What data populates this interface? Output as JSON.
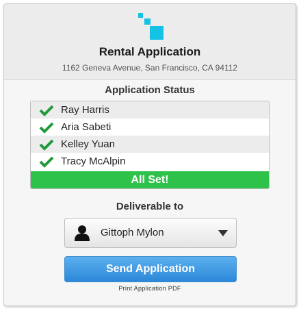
{
  "header": {
    "title": "Rental Application",
    "address": "1162 Geneva Avenue, San Francisco, CA 94112"
  },
  "status": {
    "label": "Application Status",
    "applicants": [
      {
        "name": "Ray Harris",
        "checked": true
      },
      {
        "name": "Aria Sabeti",
        "checked": true
      },
      {
        "name": "Kelley Yuan",
        "checked": true
      },
      {
        "name": "Tracy McAlpin",
        "checked": true
      }
    ],
    "summary": "All Set!"
  },
  "deliverable": {
    "label": "Deliverable to",
    "selected": "Gittoph Mylon",
    "icon": "person-icon"
  },
  "actions": {
    "send_label": "Send Application",
    "print_label": "Print Application PDF"
  },
  "colors": {
    "logo": "#16c1e6",
    "check": "#1f9a38",
    "all_set": "#2ec24a",
    "send_button": "#3a96e0"
  }
}
